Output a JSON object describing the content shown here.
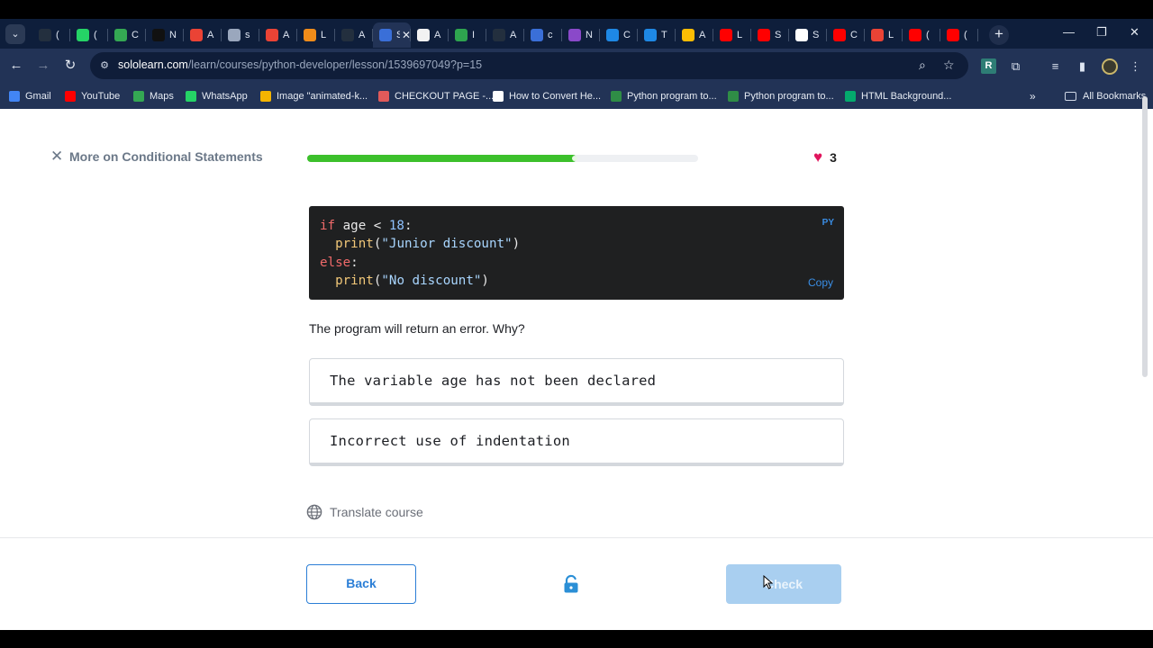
{
  "browser": {
    "tabs": [
      {
        "label": "(",
        "icon": "aws-icon",
        "color": "#232f3e"
      },
      {
        "label": "(",
        "icon": "whatsapp-icon",
        "color": "#25d366"
      },
      {
        "label": "C",
        "icon": "google-icon",
        "color": "#34a853"
      },
      {
        "label": "N",
        "icon": "notion-icon",
        "color": "#111111"
      },
      {
        "label": "A",
        "icon": "gmail-icon",
        "color": "#ea4335"
      },
      {
        "label": "s",
        "icon": "globe-icon",
        "color": "#9aa7bd"
      },
      {
        "label": "A",
        "icon": "gmail-icon",
        "color": "#ea4335"
      },
      {
        "label": "L",
        "icon": "box-icon",
        "color": "#f08c1a"
      },
      {
        "label": "A",
        "icon": "aws-icon",
        "color": "#232f3e"
      },
      {
        "label": "S",
        "icon": "sololearn-icon",
        "color": "#3a6fd8",
        "active": true
      },
      {
        "label": "A",
        "icon": "site-icon",
        "color": "#f2f2f2"
      },
      {
        "label": "I",
        "icon": "plus-green-icon",
        "color": "#2ea44f"
      },
      {
        "label": "A",
        "icon": "aws-icon",
        "color": "#232f3e"
      },
      {
        "label": "c",
        "icon": "c-logo-icon",
        "color": "#3a6fd8"
      },
      {
        "label": "N",
        "icon": "u-logo-icon",
        "color": "#8a49c9"
      },
      {
        "label": "C",
        "icon": "ist-icon",
        "color": "#1e88e5"
      },
      {
        "label": "T",
        "icon": "ist-icon",
        "color": "#1e88e5"
      },
      {
        "label": "A",
        "icon": "drive-icon",
        "color": "#fbbc04"
      },
      {
        "label": "L",
        "icon": "youtube-icon",
        "color": "#ff0000"
      },
      {
        "label": "S",
        "icon": "youtube-icon",
        "color": "#ff0000"
      },
      {
        "label": "S",
        "icon": "doc-icon",
        "color": "#ffffff"
      },
      {
        "label": "C",
        "icon": "youtube-icon",
        "color": "#ff0000"
      },
      {
        "label": "L",
        "icon": "maps-pin-icon",
        "color": "#ea4335"
      },
      {
        "label": "(",
        "icon": "youtube-icon",
        "color": "#ff0000"
      },
      {
        "label": "(",
        "icon": "youtube-icon",
        "color": "#ff0000"
      }
    ],
    "active_tab_close": "✕",
    "url_host": "sololearn.com",
    "url_path": "/learn/courses/python-developer/lesson/1539697049?p=15",
    "bookmarks": [
      {
        "label": "Gmail",
        "icon": "gmail-icon",
        "color": "#4285f4"
      },
      {
        "label": "YouTube",
        "icon": "youtube-icon",
        "color": "#ff0000"
      },
      {
        "label": "Maps",
        "icon": "maps-pin-icon",
        "color": "#34a853"
      },
      {
        "label": "WhatsApp",
        "icon": "whatsapp-icon",
        "color": "#25d366"
      },
      {
        "label": "Image \"animated-k...",
        "icon": "star-icon",
        "color": "#f4b400"
      },
      {
        "label": "CHECKOUT PAGE -...",
        "icon": "checkout-icon",
        "color": "#e05a5a"
      },
      {
        "label": "How to Convert He...",
        "icon": "alpha-icon",
        "color": "#ffffff"
      },
      {
        "label": "Python program to...",
        "icon": "gfg-icon",
        "color": "#2f8d46"
      },
      {
        "label": "Python program to...",
        "icon": "gfg-icon",
        "color": "#2f8d46"
      },
      {
        "label": "HTML Background...",
        "icon": "w3-icon",
        "color": "#04aa6d"
      }
    ],
    "all_bookmarks": "All Bookmarks"
  },
  "lesson": {
    "close_label": "More on Conditional Statements",
    "progress_fraction": 0.69,
    "hearts": "3",
    "code": {
      "lang": "PY",
      "copy_label": "Copy",
      "line1": {
        "kw": "if",
        "mid": " age < ",
        "num": "18",
        "end": ":"
      },
      "line2": {
        "fn": "print",
        "open": "(",
        "str": "\"Junior discount\"",
        "close": ")"
      },
      "line3": {
        "kw": "else",
        "end": ":"
      },
      "line4": {
        "fn": "print",
        "open": "(",
        "str": "\"No discount\"",
        "close": ")"
      }
    },
    "question": "The program will return an error. Why?",
    "options": [
      "The variable age has not been declared",
      "Incorrect use of indentation"
    ],
    "translate_label": "Translate course",
    "back_label": "Back",
    "check_label": "Check"
  },
  "colors": {
    "progress": "#3cc02b",
    "heart": "#e0155d",
    "primary": "#2b7ed6",
    "check_disabled": "#a9cff0"
  }
}
